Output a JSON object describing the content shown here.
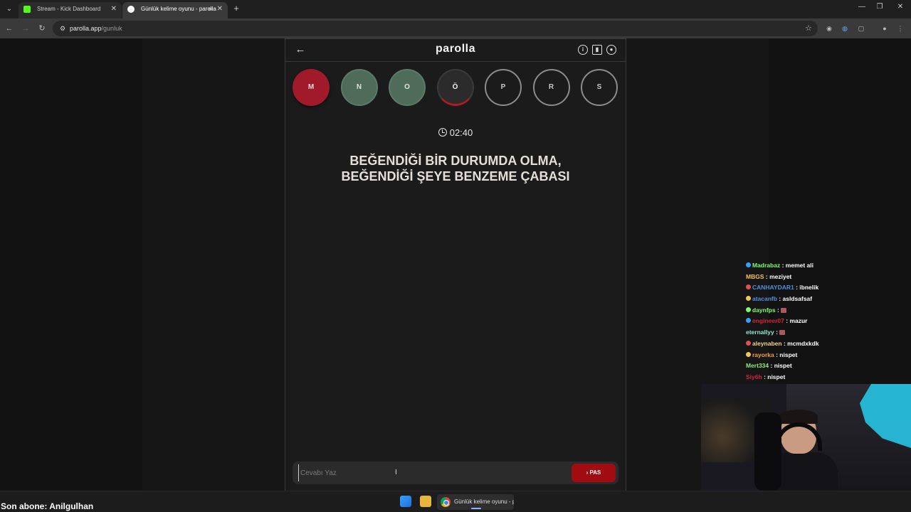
{
  "browser": {
    "tabs": [
      {
        "title": "Stream - Kick Dashboard",
        "favicon_color": "#53fc18"
      },
      {
        "title": "Günlük kelime oyunu - parolla",
        "favicon_color": "#ffffff"
      }
    ],
    "url_host": "parolla.app",
    "url_path": "/gunluk"
  },
  "app": {
    "logo": "parolla",
    "letters": [
      {
        "char": "M",
        "state": "wrong"
      },
      {
        "char": "N",
        "state": "correct"
      },
      {
        "char": "O",
        "state": "correct"
      },
      {
        "char": "Ö",
        "state": "current"
      },
      {
        "char": "P",
        "state": "pending"
      },
      {
        "char": "R",
        "state": "pending"
      },
      {
        "char": "S",
        "state": "pending"
      }
    ],
    "timer": "02:40",
    "question_line1": "BEĞENDİĞİ BİR DURUMDA OLMA,",
    "question_line2": "BEĞENDİĞİ ŞEYE BENZEME ÇABASI",
    "answer_placeholder": "Cevabı Yaz",
    "pass_label": "PAS",
    "colors": {
      "wrong": "#a11a2c",
      "correct": "#4f6b5a",
      "pass": "#a10c12"
    }
  },
  "chat": [
    {
      "user": "Madrabaz",
      "msg": ": memet ali",
      "color": "#7cfc6c"
    },
    {
      "user": "MBGS",
      "msg": ": meziyet",
      "color": "#f2c45c"
    },
    {
      "user": "CANHAYDAR1",
      "msg": ": ibnelik",
      "color": "#4f8fe0"
    },
    {
      "user": "atacanfb",
      "msg": ": asldsafsaf",
      "color": "#4f8fe0"
    },
    {
      "user": "daynfps",
      "msg": ":",
      "color": "#7cfc6c",
      "emote": true
    },
    {
      "user": "engineer07",
      "msg": ": mazur",
      "color": "#d2253a"
    },
    {
      "user": "eternallyy",
      "msg": ":",
      "color": "#8fe8d0",
      "emote": true
    },
    {
      "user": "aleynaben",
      "msg": ": mcmdxkdk",
      "color": "#f2d58c"
    },
    {
      "user": "rayorka",
      "msg": ": nispet",
      "color": "#f0a040"
    },
    {
      "user": "Mert334",
      "msg": ": nispet",
      "color": "#8fe87c"
    },
    {
      "user": "Siy6h",
      "msg": ": nispet",
      "color": "#d2253a"
    }
  ],
  "overlay": {
    "son_abone": "Son abone: Anilgulhan"
  },
  "taskbar": {
    "active_app": "Günlük kelime oyunu - parolla"
  }
}
